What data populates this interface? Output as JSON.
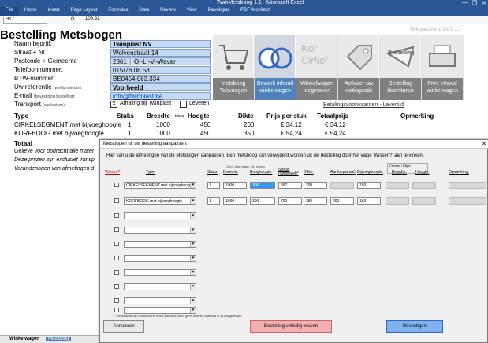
{
  "window": {
    "title": "TwinMetsboog 1.1 - Microsoft Excel",
    "controls": [
      "—",
      "❐",
      "✕"
    ]
  },
  "ribbon_tabs": [
    "File",
    "Home",
    "Insert",
    "Page Layout",
    "Formulas",
    "Data",
    "Review",
    "View",
    "Developer",
    "PDF Architect"
  ],
  "formula_bar": {
    "name_box": "H17",
    "fx": "fx",
    "value": "106,92"
  },
  "sheet": {
    "title": "Bestelling Metsbogen",
    "version": "Twinplast.tm.nl 2010 1.1",
    "fields": [
      {
        "label": "Naam bedrijf:",
        "sub": "",
        "value": "Twinplast NV"
      },
      {
        "label": "Straat + Nr",
        "sub": "",
        "value": "Wolvenstraat 14"
      },
      {
        "label": "Postcode + Gemeente",
        "sub": "",
        "value": "2861",
        "value2": "O.-L.-V.-Waver"
      },
      {
        "label": "Telefoonnummer:",
        "sub": "",
        "value": "015/76.08.58"
      },
      {
        "label": "BTW-nummer:",
        "sub": "",
        "value": "BE0454.063.334"
      },
      {
        "label": "Uw referentie",
        "sub": "(werf/projecttor):",
        "value": "Voorbeeld"
      },
      {
        "label": "E-mail",
        "sub": "(bevestiging bestelling):",
        "value": "info@twinplast.be"
      },
      {
        "label": "Transport",
        "sub": "(aankruisen):",
        "value": ""
      }
    ],
    "transport": {
      "opt1_mark": "X",
      "opt1": "Afhaling bij Twinplast",
      "opt2": "Leveren"
    },
    "buttons": [
      "Metsboog Toevoegen",
      "Bewerk inhoud winkelwagen",
      "Winkelwagen leegmaken",
      "Activeer uw kortingcode",
      "Bestelling doorsturen",
      "Print inhoud winkelwagen"
    ],
    "image_labels": [
      "Kor Cirkel",
      "Bestelling"
    ],
    "links": [
      "Betalingsvoorwaarden",
      "Levertijd"
    ],
    "columns": [
      "Type",
      "Stuks",
      "Breedte",
      "totaal",
      "Hoogte",
      "Dikte",
      "Prijs per stuk",
      "Totaalprijs",
      "Opmerking"
    ],
    "rows": [
      {
        "type": "CIRKELSEGMENT met bijvoeghoogte",
        "stuks": "1",
        "breedte": "1000",
        "hoogte": "450",
        "dikte": "200",
        "prijs": "€ 34,12",
        "totaal": "€ 34,12"
      },
      {
        "type": "KORFBOOG met bijvoeghoogte",
        "stuks": "1",
        "breedte": "1000",
        "hoogte": "450",
        "dikte": "350",
        "prijs": "€ 54,24",
        "totaal": "€ 54,24"
      }
    ],
    "totaal_label": "Totaal",
    "footer_notes": [
      "Gelieve voor opdracht alle mater",
      "Deze prijzen zijn exclusief transp",
      "Veranderingen van afmetingen d"
    ],
    "sheet_tabs": [
      "Winkelwagen",
      "Metsboog"
    ]
  },
  "dialog": {
    "title": "Metsbogen uit uw bestelling aanpassen:",
    "close": "✕",
    "intro": "Hier kan u de afmetingen van de Metsbogen aanpassen. Een metsboog kan verwijderd worden uit uw bestelling door het vakje 'Wissen?' aan te vinken.",
    "hint": "Opm: Alle maten zijn in mm",
    "group": "Cilinder / Ellips",
    "col_headers": {
      "wissen": "Wissen?",
      "type": "Type:",
      "stuks": "Stuks:",
      "breedte": "Breedte:",
      "booghoogte": "Booghoogte:",
      "straal": "Straal: (optioneel)*",
      "dikte": "Dikte:",
      "aanloop": "Aanloopstraal:",
      "bijvoeg": "Bijvoeghoogte:",
      "breedte2": "Breedte:",
      "hoogte": "Hoogte:",
      "opm": "Opmerking:"
    },
    "rows": [
      {
        "type": "CIRKELSEGMENT met bijvoeghoogte",
        "stuks": "1",
        "breedte": "1000",
        "booghoogte": "300",
        "straal": "567",
        "dikte": "200",
        "aanloop": "",
        "bijvoeg": "150"
      },
      {
        "type": "KORFBOOG met bijvoeghoogte",
        "stuks": "1",
        "breedte": "1000",
        "booghoogte": "300",
        "straal": "700",
        "dikte": "350",
        "aanloop": "200",
        "bijvoeg": "150"
      }
    ],
    "note": "* De waarde van Straal wordt enkel gebruikt als er geen waarde ingevuld is bij Booghoogte.",
    "buttons": {
      "cancel": "Annuleren",
      "clear": "Bestelling volledig wissen",
      "confirm": "Bevestigen"
    }
  }
}
